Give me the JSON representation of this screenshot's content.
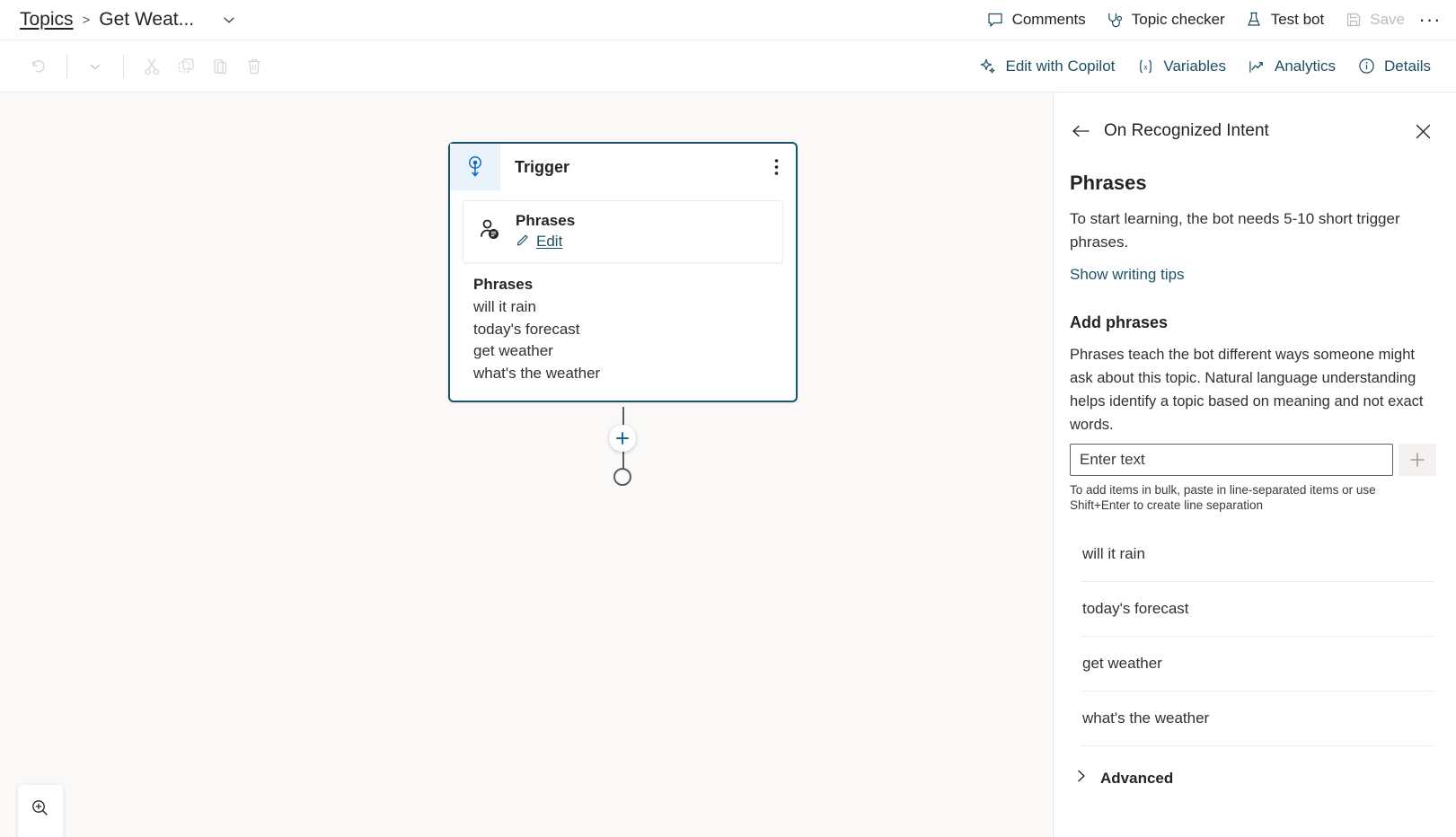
{
  "header": {
    "breadcrumb": {
      "root": "Topics",
      "separator": ">",
      "current": "Get Weat...",
      "chevron_icon": "chevron-down-icon"
    },
    "actions": [
      {
        "label": "Comments",
        "icon": "comment-icon",
        "disabled": false
      },
      {
        "label": "Topic checker",
        "icon": "stethoscope-icon",
        "disabled": false
      },
      {
        "label": "Test bot",
        "icon": "flask-icon",
        "disabled": false
      },
      {
        "label": "Save",
        "icon": "save-icon",
        "disabled": true
      }
    ],
    "overflow": "···"
  },
  "toolbar": {
    "left_icons": [
      {
        "name": "undo-icon",
        "disabled": true
      },
      {
        "name": "chevron-down-icon",
        "disabled": true
      },
      {
        "name": "cut-icon",
        "disabled": true
      },
      {
        "name": "copy-icon",
        "disabled": true
      },
      {
        "name": "paste-icon",
        "disabled": true
      },
      {
        "name": "delete-icon",
        "disabled": true
      }
    ],
    "right_buttons": [
      {
        "label": "Edit with Copilot",
        "icon": "sparkle-icon"
      },
      {
        "label": "Variables",
        "icon": "variables-icon"
      },
      {
        "label": "Analytics",
        "icon": "analytics-icon"
      },
      {
        "label": "Details",
        "icon": "info-icon"
      }
    ]
  },
  "canvas": {
    "node": {
      "icon": "trigger-icon",
      "title": "Trigger",
      "more_icon": "more-vertical-icon",
      "phrase_card": {
        "icon": "person-speech-icon",
        "title": "Phrases",
        "edit_label": "Edit",
        "edit_icon": "pencil-icon"
      },
      "list_title": "Phrases",
      "list_items": [
        "will it rain",
        "today's forecast",
        "get weather",
        "what's the weather"
      ]
    },
    "connector": {
      "add_icon": "plus-circle-icon",
      "end_icon": "end-node-icon"
    },
    "zoom_control": {
      "icon": "zoom-in-icon"
    }
  },
  "panel": {
    "back_icon": "back-arrow-icon",
    "title": "On Recognized Intent",
    "close_icon": "close-icon",
    "heading": "Phrases",
    "description": "To start learning, the bot needs 5-10 short trigger phrases.",
    "writing_tips_link": "Show writing tips",
    "add_heading": "Add phrases",
    "add_paragraph": "Phrases teach the bot different ways someone might ask about this topic. Natural language understanding helps identify a topic based on meaning and not exact words.",
    "input": {
      "value": "",
      "placeholder": "Enter text"
    },
    "add_button_icon": "plus-icon",
    "bulk_hint": "To add items in bulk, paste in line-separated items or use Shift+Enter to create line separation",
    "phrases": [
      "will it rain",
      "today's forecast",
      "get weather",
      "what's the weather"
    ],
    "advanced": {
      "label": "Advanced",
      "icon": "chevron-right-icon"
    }
  },
  "colors": {
    "accent": "#1d5366",
    "node_border": "#1d5366",
    "trigger_tile": "#eaf3fb",
    "canvas_bg": "#faf9f8"
  }
}
